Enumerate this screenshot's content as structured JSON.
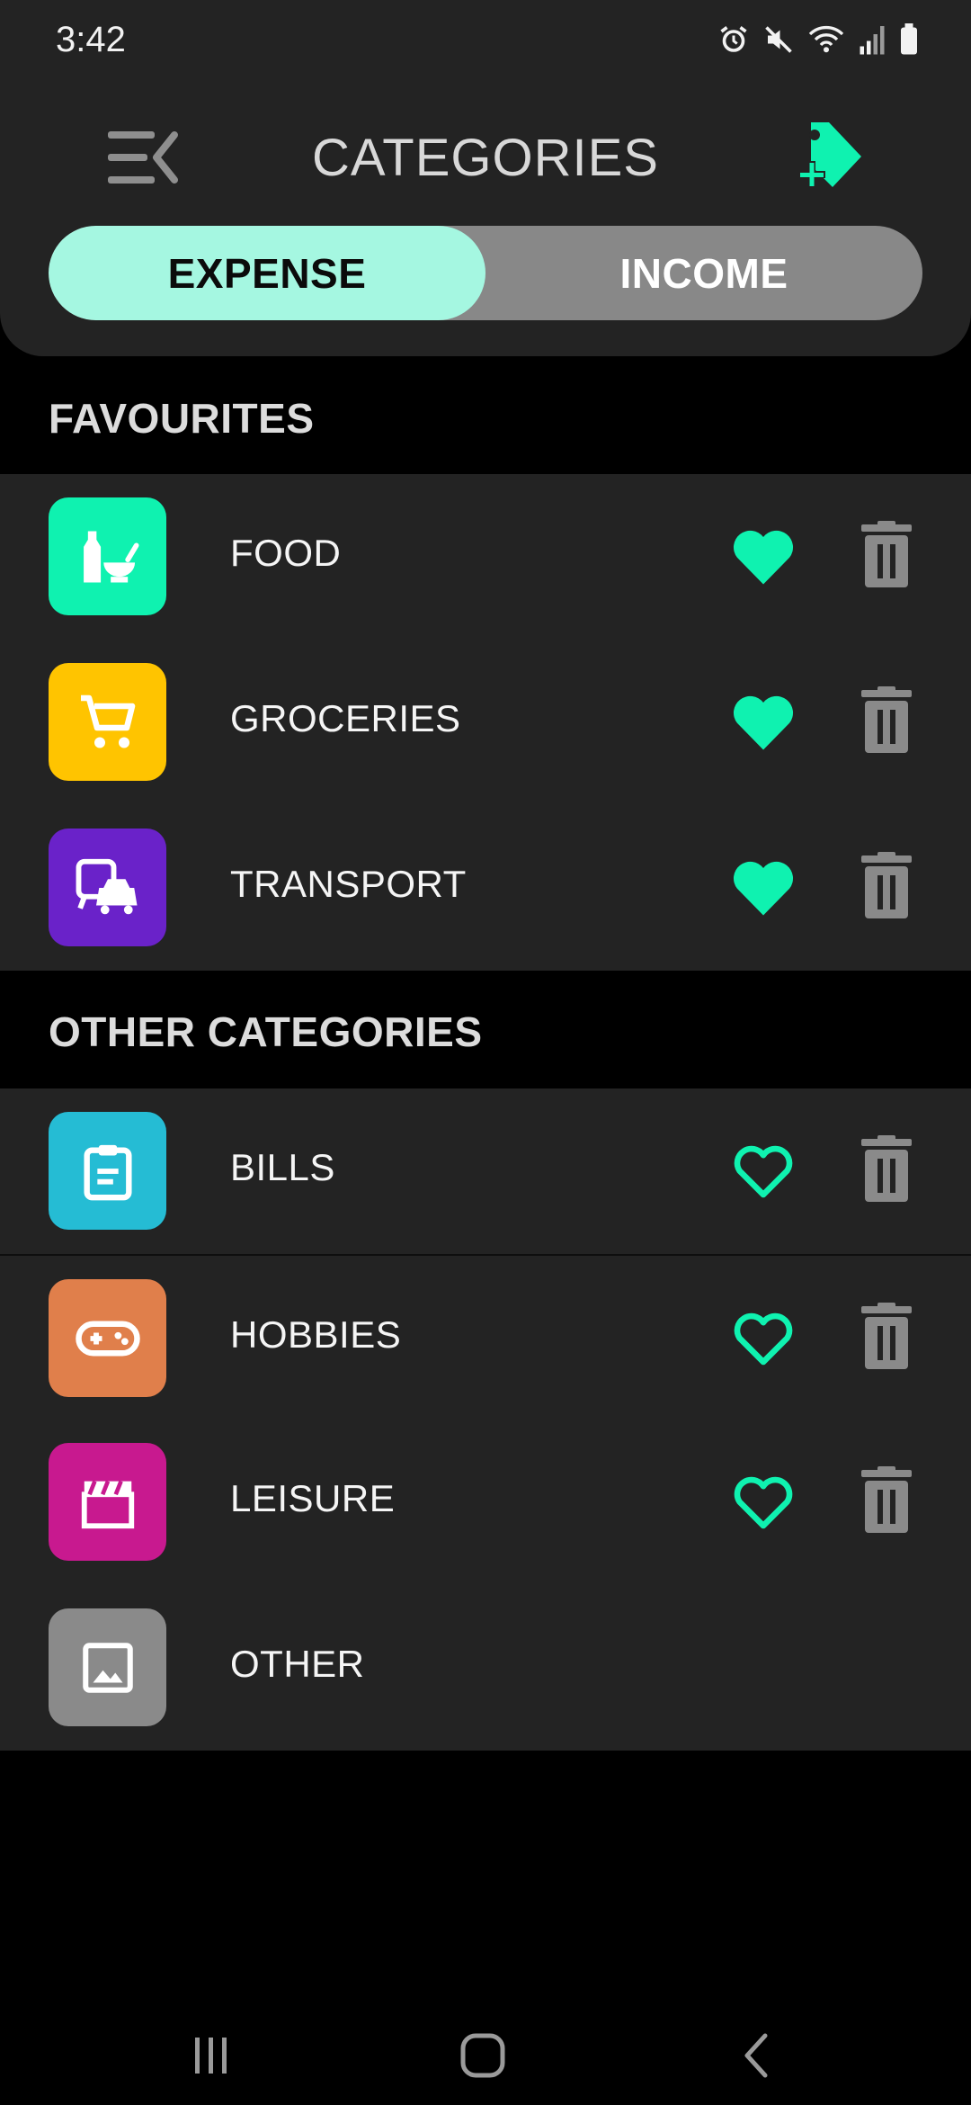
{
  "status": {
    "time": "3:42",
    "icons": [
      "alarm-icon",
      "mute-icon",
      "wifi-icon",
      "signal-icon",
      "battery-icon"
    ]
  },
  "header": {
    "title": "CATEGORIES",
    "menu_icon": "menu-collapse-icon",
    "add_icon": "add-tag-icon"
  },
  "toggle": {
    "expense_label": "EXPENSE",
    "income_label": "INCOME",
    "selected": "EXPENSE"
  },
  "favourites": {
    "title": "FAVOURITES",
    "items": [
      {
        "label": "FOOD",
        "icon": "food-icon",
        "color": "#0ff2b0",
        "favourite": true
      },
      {
        "label": "GROCERIES",
        "icon": "cart-icon",
        "color": "#ffc400",
        "favourite": true
      },
      {
        "label": "TRANSPORT",
        "icon": "transport-icon",
        "color": "#6a22c9",
        "favourite": true
      }
    ]
  },
  "other": {
    "title": "OTHER CATEGORIES",
    "items": [
      {
        "label": "BILLS",
        "icon": "clipboard-icon",
        "color": "#25bcd4",
        "favourite": false
      },
      {
        "label": "HOBBIES",
        "icon": "gamepad-icon",
        "color": "#e07f4b",
        "favourite": false
      },
      {
        "label": "LEISURE",
        "icon": "clapperboard-icon",
        "color": "#c8198f",
        "favourite": false
      },
      {
        "label": "OTHER",
        "icon": "image-icon",
        "color": "#8a8a8a",
        "favourite": null
      }
    ]
  },
  "colors": {
    "accent": "#0ff2b0",
    "panel": "#232323",
    "background": "#000000",
    "trash": "#8a8a8a"
  },
  "nav": {
    "icons": [
      "recent-apps-icon",
      "home-icon",
      "back-icon"
    ]
  }
}
